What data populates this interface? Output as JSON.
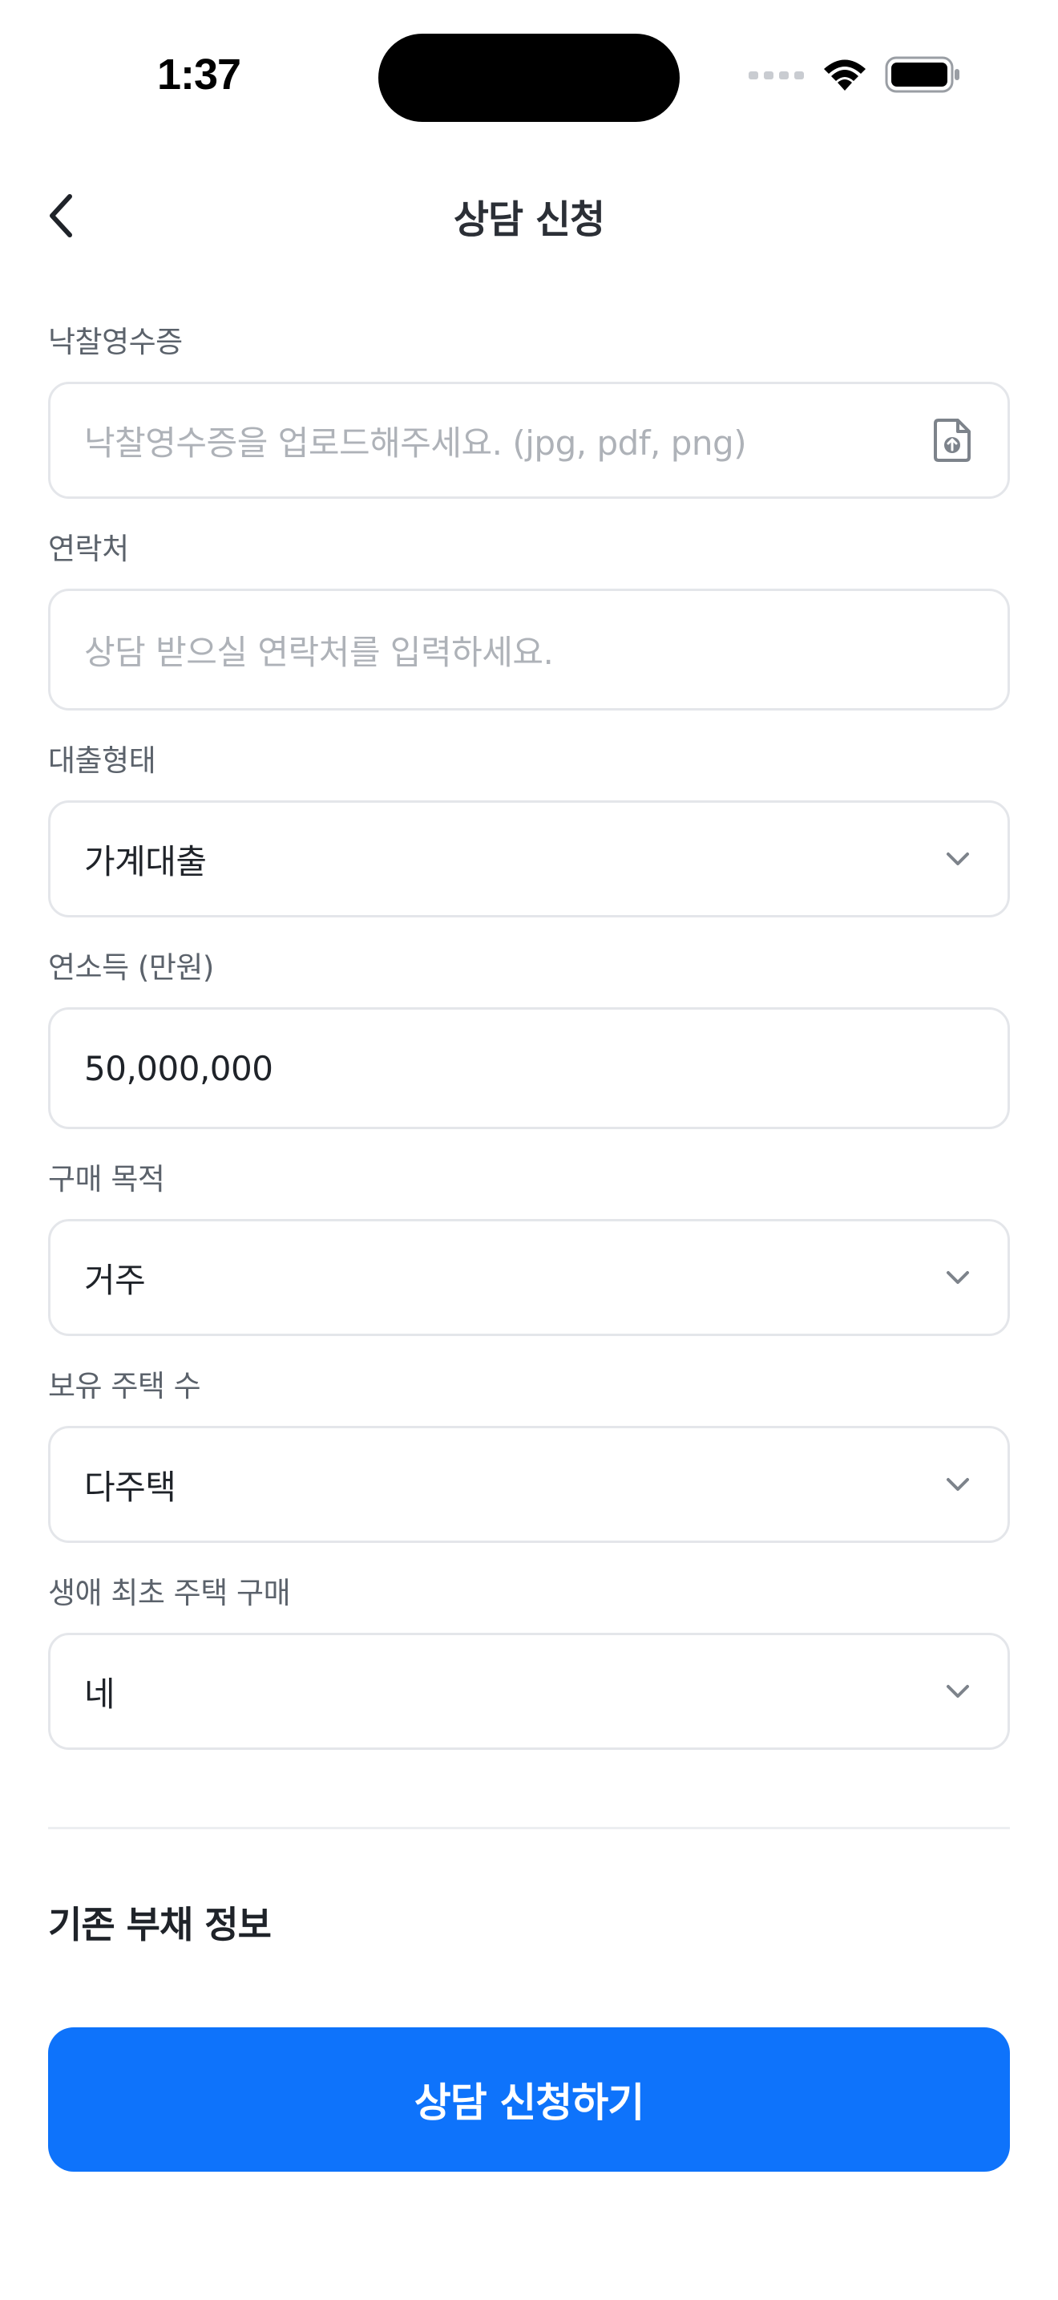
{
  "status_bar": {
    "time": "1:37"
  },
  "header": {
    "title": "상담 신청",
    "back_icon": "chevron-left-icon"
  },
  "form": {
    "receipt": {
      "label": "낙찰영수증",
      "placeholder": "낙찰영수증을 업로드해주세요. (jpg, pdf, png)",
      "icon": "file-upload-icon"
    },
    "contact": {
      "label": "연락처",
      "placeholder": "상담 받으실 연락처를 입력하세요."
    },
    "loan_type": {
      "label": "대출형태",
      "value": "가계대출",
      "icon": "chevron-down-icon"
    },
    "annual_income": {
      "label": "연소득 (만원)",
      "value": "50,000,000"
    },
    "purchase_purpose": {
      "label": "구매 목적",
      "value": "거주",
      "icon": "chevron-down-icon"
    },
    "houses_owned": {
      "label": "보유 주택 수",
      "value": "다주택",
      "icon": "chevron-down-icon"
    },
    "first_home": {
      "label": "생애 최초 주택 구매",
      "value": "네",
      "icon": "chevron-down-icon"
    }
  },
  "existing_debt": {
    "title": "기존 부채 정보"
  },
  "submit": {
    "label": "상담 신청하기"
  },
  "colors": {
    "accent": "#0e73fb",
    "border": "#e4e6ea",
    "label": "#5b626b",
    "placeholder": "#aeb2b8"
  }
}
